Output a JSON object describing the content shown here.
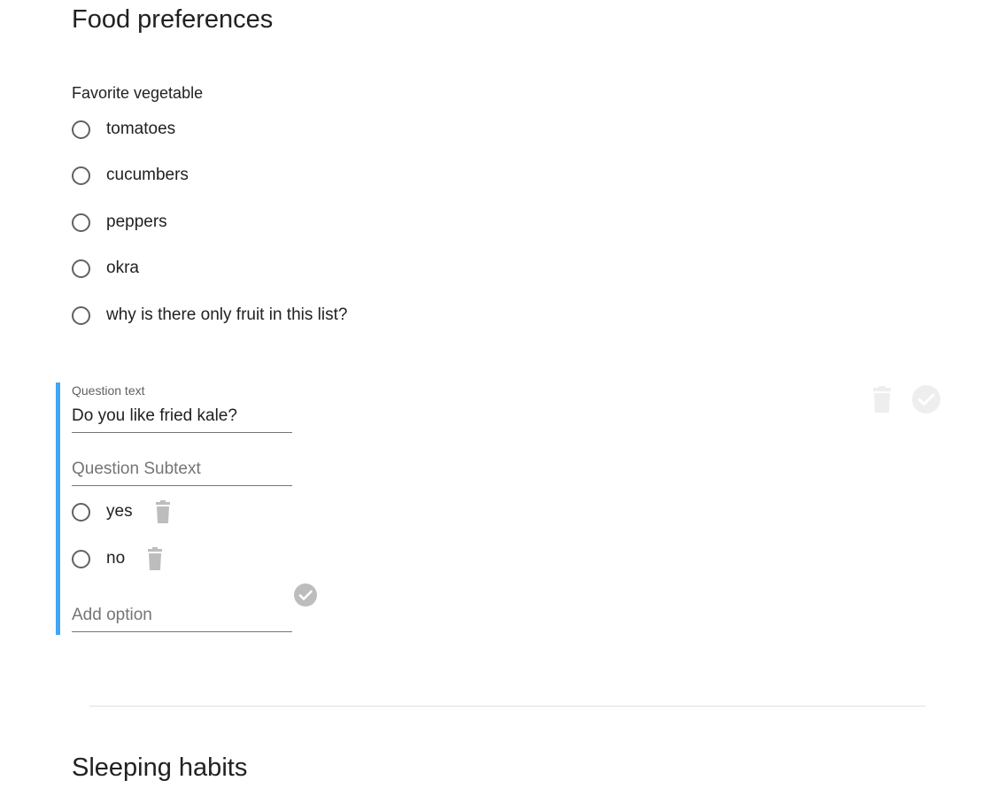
{
  "sections": {
    "food": {
      "title": "Food preferences"
    },
    "sleep": {
      "title": "Sleeping habits"
    }
  },
  "question1": {
    "label": "Favorite vegetable",
    "options": [
      {
        "label": "tomatoes",
        "selected": false
      },
      {
        "label": "cucumbers",
        "selected": false
      },
      {
        "label": "peppers",
        "selected": false
      },
      {
        "label": "okra",
        "selected": false
      },
      {
        "label": "why is there only fruit in this list?",
        "selected": false
      }
    ]
  },
  "editor": {
    "question_text_label": "Question text",
    "question_text_value": "Do you like fried kale?",
    "subtext_placeholder": "Question Subtext",
    "options": [
      {
        "label": "yes",
        "selected": false
      },
      {
        "label": "no",
        "selected": false
      }
    ],
    "add_option_placeholder": "Add option",
    "icons": {
      "delete_question": "trash-icon",
      "confirm_question": "check-circle-icon",
      "delete_option": "trash-icon",
      "confirm_add_option": "check-circle-icon"
    },
    "colors": {
      "accent_bar": "#42a5f5",
      "icon_muted": "#bdbdbd",
      "icon_faint": "#eeeeee"
    }
  }
}
